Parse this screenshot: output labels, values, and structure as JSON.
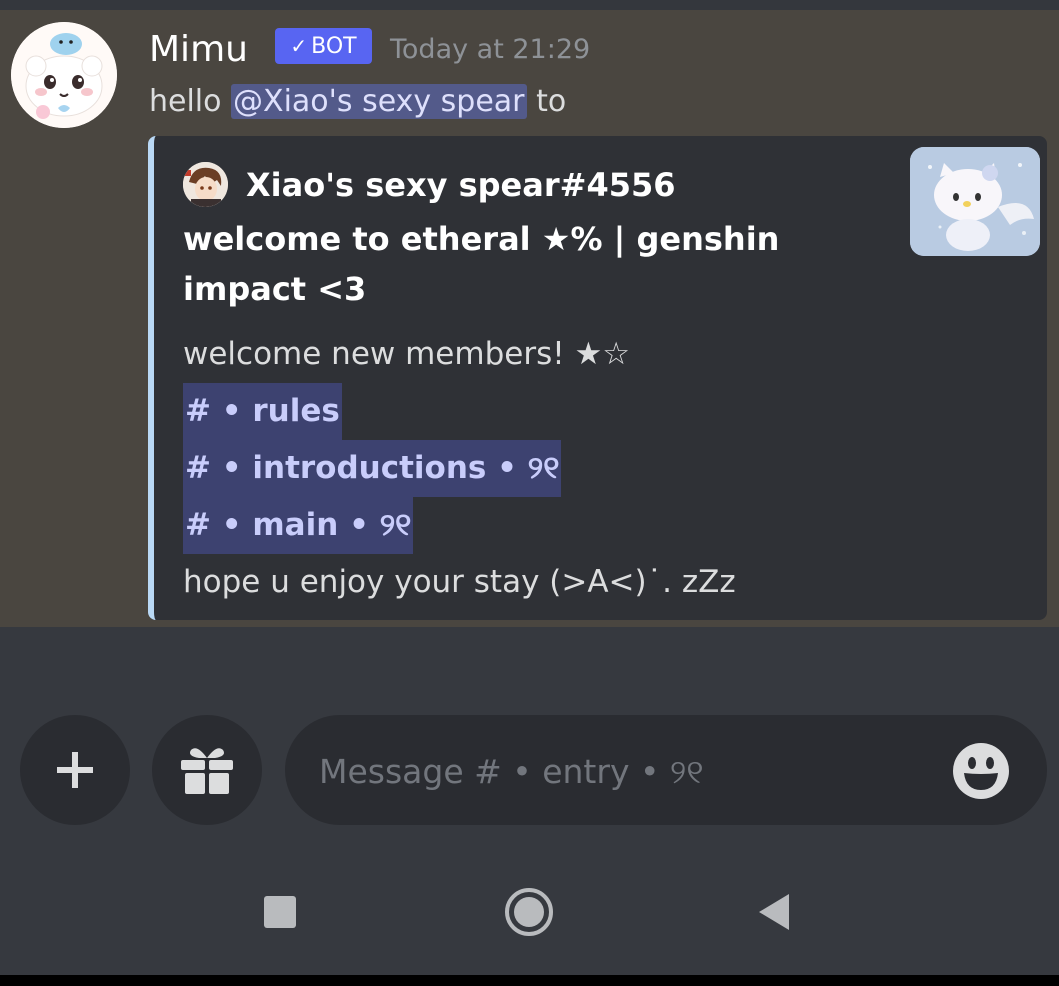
{
  "message": {
    "username": "Mimu",
    "bot_tag": "BOT",
    "bot_check": "✓",
    "timestamp": "Today at 21:29",
    "text_before": "hello ",
    "mention": "@Xiao's sexy spear",
    "text_after": " to"
  },
  "embed": {
    "accent_color": "#b9d8f5",
    "author_name": "Xiao's sexy spear#4556",
    "title": "welcome to etheral ★% | genshin impact <3",
    "welcome_line": "welcome new members! ★☆",
    "channels": [
      "# • rules",
      "# • introductions • ୨୧",
      "# • main • ୨୧"
    ],
    "footer_line": "hope u enjoy your stay (>A<)˙. zZz"
  },
  "composer": {
    "placeholder": "Message # • entry • ୨୧",
    "plus_icon": "plus-icon",
    "gift_icon": "gift-icon",
    "emoji_icon": "smile-emoji-icon"
  },
  "nav": {
    "recents_icon": "square-icon",
    "home_icon": "circle-icon",
    "back_icon": "triangle-back-icon"
  },
  "colors": {
    "message_bg": "#4a4640",
    "app_bg": "#36393f",
    "embed_bg": "#2f3136",
    "bot_tag": "#5865f2",
    "mention_bg": "#535a8a",
    "channel_bg": "#3d4270"
  }
}
